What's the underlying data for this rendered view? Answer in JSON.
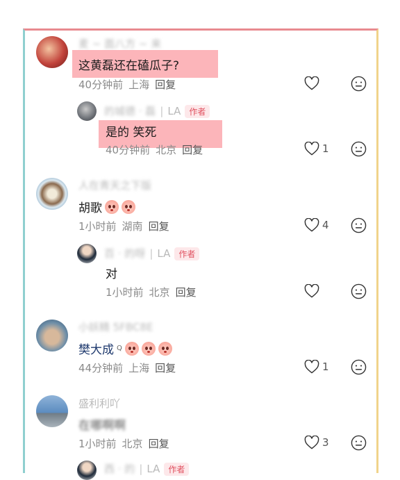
{
  "comments": [
    {
      "name": "麦 ~ 面八方 ~ 来",
      "text": "这黄磊还在磕瓜子?",
      "time": "40分钟前",
      "location": "上海",
      "reply": "回复",
      "likes": ""
    },
    {
      "name": "的城德 · 磊",
      "la": "LA",
      "badge": "作者",
      "text": "是的 笑死",
      "time": "40分钟前",
      "location": "北京",
      "reply": "回复",
      "likes": "1"
    },
    {
      "name": "人在青天之下版",
      "text": "胡歌",
      "time": "1小时前",
      "location": "湖南",
      "reply": "回复",
      "likes": "4"
    },
    {
      "name": "百 · 的呀",
      "la": "LA",
      "badge": "作者",
      "text": "对",
      "time": "1小时前",
      "location": "北京",
      "reply": "回复",
      "likes": ""
    },
    {
      "name": "小妖精 5FBC8E",
      "text": "樊大成",
      "time": "44分钟前",
      "location": "上海",
      "reply": "回复",
      "likes": "1"
    },
    {
      "name": "盛利利吖",
      "text": "在哪啊啊",
      "time": "1小时前",
      "location": "北京",
      "reply": "回复",
      "likes": "3"
    },
    {
      "name": "西 · 的",
      "la": "LA",
      "badge": "作者"
    }
  ],
  "icons": {
    "like": "heart-outline-icon",
    "dislike": "neutral-face-icon",
    "search": "search-icon"
  },
  "colors": {
    "highlight": "#fa7882",
    "author_badge": "#e0505f"
  }
}
